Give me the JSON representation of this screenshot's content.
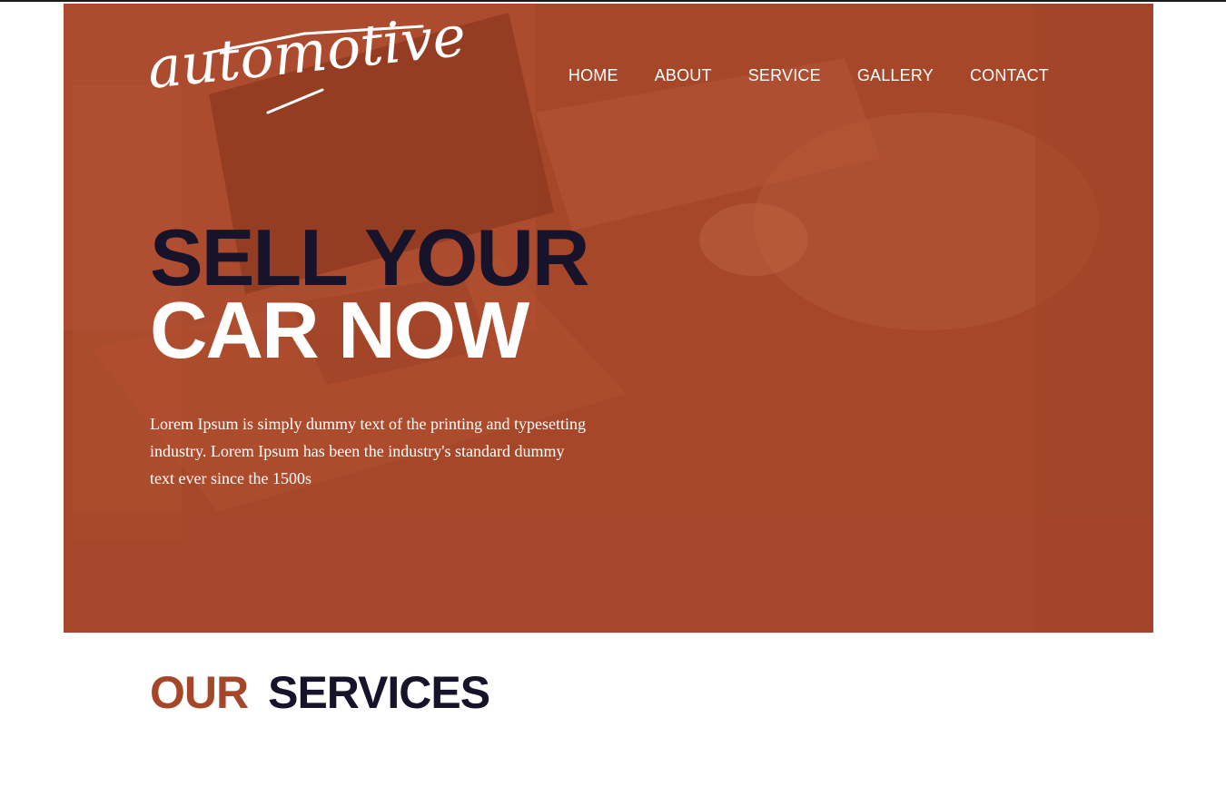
{
  "brand": {
    "logo_text": "automotive"
  },
  "nav": {
    "items": [
      {
        "label": "HOME"
      },
      {
        "label": "ABOUT"
      },
      {
        "label": "SERVICE"
      },
      {
        "label": "GALLERY"
      },
      {
        "label": "CONTACT"
      }
    ]
  },
  "hero": {
    "headline_line1": "SELL YOUR",
    "headline_line2": "CAR NOW",
    "body": "Lorem Ipsum is simply dummy text of the printing and typesetting industry. Lorem Ipsum has been the industry's standard dummy text ever since the 1500s"
  },
  "services": {
    "title_accent": "OUR",
    "title_main": "SERVICES"
  },
  "colors": {
    "accent": "#a7472a",
    "dark": "#17132a",
    "white": "#ffffff"
  }
}
